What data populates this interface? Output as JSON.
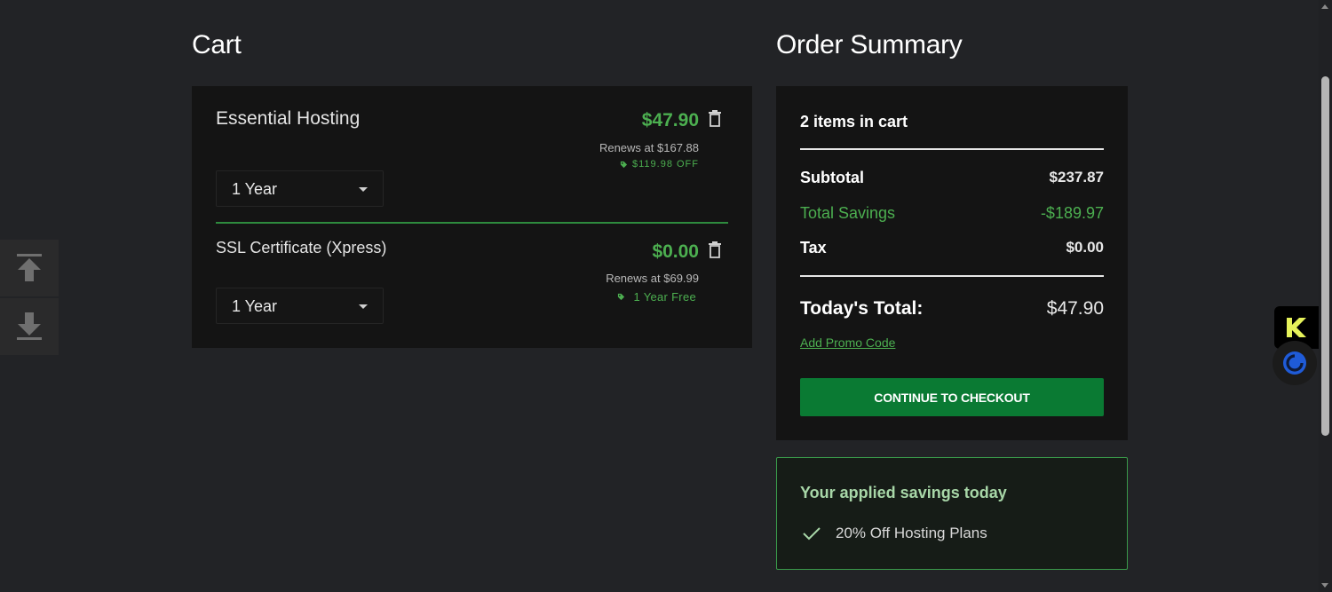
{
  "cart": {
    "heading": "Cart",
    "items": [
      {
        "name": "Essential Hosting",
        "price": "$47.90",
        "renews_label": "Renews at",
        "renews_price": "$167.88",
        "discount": "$119.98 OFF",
        "term": "1 Year"
      },
      {
        "name": "SSL Certificate (Xpress)",
        "price": "$0.00",
        "renews_label": "Renews at",
        "renews_price": "$69.99",
        "discount": "1 Year Free",
        "term": "1 Year"
      }
    ]
  },
  "summary": {
    "heading": "Order Summary",
    "items_count": "2 items in cart",
    "subtotal_label": "Subtotal",
    "subtotal_value": "$237.87",
    "savings_label": "Total Savings",
    "savings_value": "-$189.97",
    "tax_label": "Tax",
    "tax_value": "$0.00",
    "total_label": "Today's Total:",
    "total_value": "$47.90",
    "promo_link": "Add Promo Code",
    "checkout_label": "CONTINUE TO CHECKOUT"
  },
  "applied_savings": {
    "title": "Your applied savings today",
    "items": [
      "20% Off Hosting Plans"
    ]
  },
  "icons": {
    "trash": "trash-icon",
    "tag": "tag-icon",
    "check": "check-icon",
    "scroll_up": "arrow-up-icon",
    "scroll_down": "arrow-down-icon",
    "extension_k": "k-logo-icon",
    "extension_circle": "spinner-icon"
  },
  "colors": {
    "background": "#222326",
    "panel": "#141414",
    "accent_green": "#4caf50",
    "button_green": "#0a7a33"
  }
}
